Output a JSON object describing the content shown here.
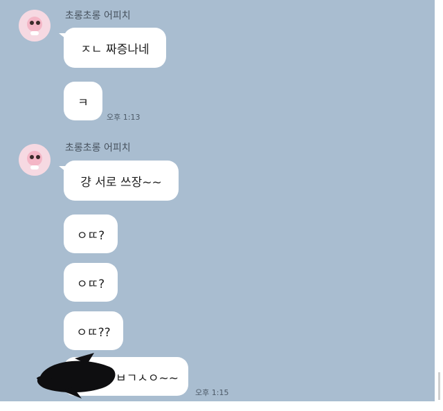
{
  "chat": {
    "groups": [
      {
        "sender": "초롱초롱 어피치",
        "messages": [
          "ㅈㄴ 짜증나네",
          "ㅋ"
        ],
        "time": "오후 1:13"
      },
      {
        "sender": "초롱초롱 어피치",
        "messages": [
          "걍 서로 쓰장~~",
          "ㅇㄸ?",
          "ㅇㄸ?",
          "ㅇㄸ??",
          "ㅂㄱㅅㅇ~~"
        ],
        "time": "오후 1:15"
      }
    ]
  },
  "colors": {
    "background": "#a9bdd0",
    "bubble": "#ffffff"
  }
}
